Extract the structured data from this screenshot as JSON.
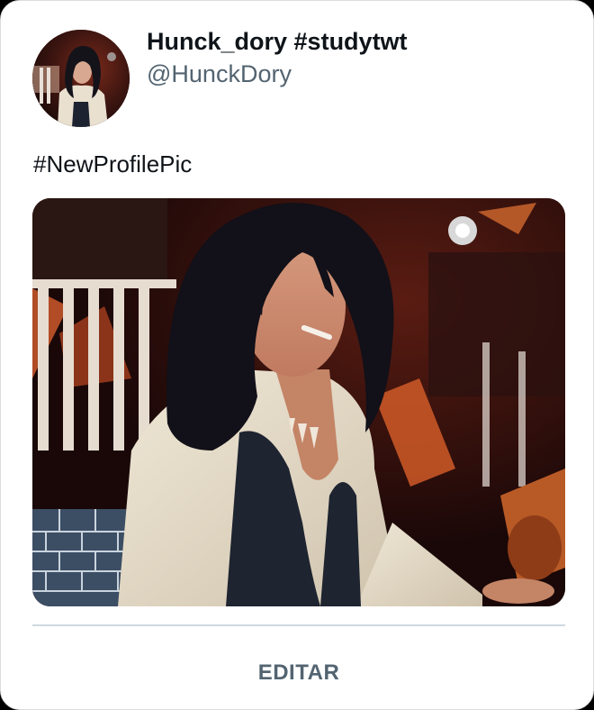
{
  "profile": {
    "display_name": "Hunck_dory #studytwt",
    "handle": "@HunckDory"
  },
  "tweet": {
    "text": "#NewProfilePic"
  },
  "actions": {
    "edit_label": "EDITAR"
  },
  "colors": {
    "card_background": "#ffffff",
    "name_text": "#0f1419",
    "secondary_text": "#536471",
    "divider": "#cfd9de"
  }
}
